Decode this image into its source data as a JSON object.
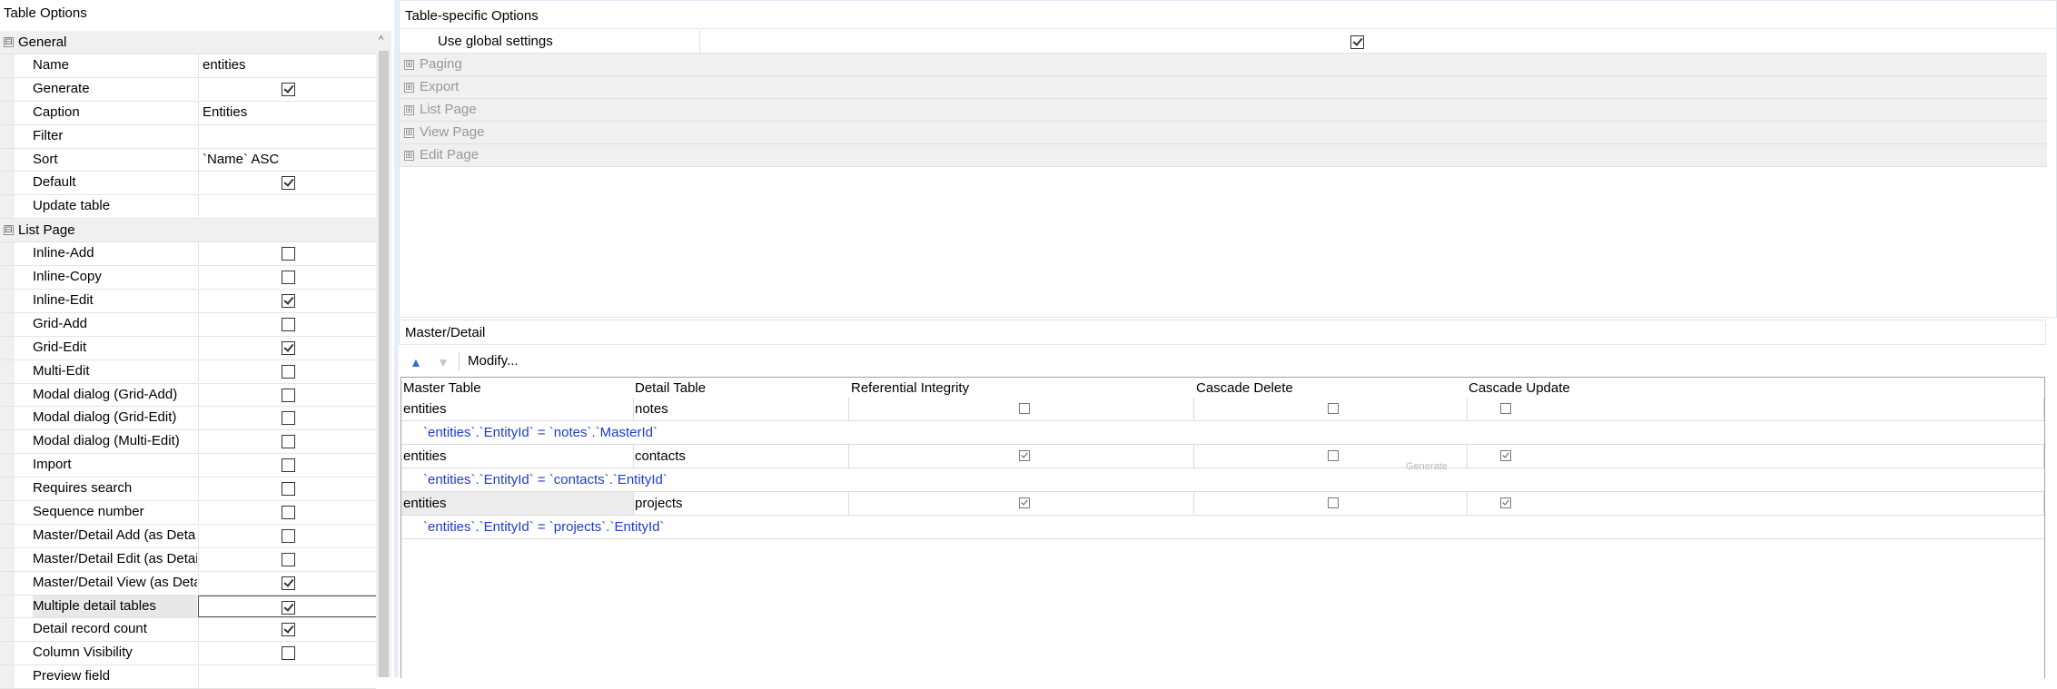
{
  "left": {
    "title": "Table Options",
    "categories": [
      {
        "label": "General",
        "expander": "⊟"
      },
      {
        "label": "List Page",
        "expander": "⊟"
      }
    ],
    "general": [
      {
        "name": "Name",
        "value": "entities"
      },
      {
        "name": "Generate",
        "checked": true
      },
      {
        "name": "Caption",
        "value": "Entities"
      },
      {
        "name": "Filter",
        "value": ""
      },
      {
        "name": "Sort",
        "value": "`Name` ASC"
      },
      {
        "name": "Default",
        "checked": true
      },
      {
        "name": "Update table",
        "value": ""
      }
    ],
    "list_page": [
      {
        "name": "Inline-Add",
        "checked": false
      },
      {
        "name": "Inline-Copy",
        "checked": false
      },
      {
        "name": "Inline-Edit",
        "checked": true
      },
      {
        "name": "Grid-Add",
        "checked": false
      },
      {
        "name": "Grid-Edit",
        "checked": true
      },
      {
        "name": "Multi-Edit",
        "checked": false
      },
      {
        "name": "Modal dialog (Grid-Add)",
        "checked": false
      },
      {
        "name": "Modal dialog (Grid-Edit)",
        "checked": false
      },
      {
        "name": "Modal dialog (Multi-Edit)",
        "checked": false
      },
      {
        "name": "Import",
        "checked": false
      },
      {
        "name": "Requires search",
        "checked": false
      },
      {
        "name": "Sequence number",
        "checked": false
      },
      {
        "name": "Master/Detail Add (as Deta",
        "checked": false
      },
      {
        "name": "Master/Detail Edit (as Detai",
        "checked": false
      },
      {
        "name": "Master/Detail View (as Deta",
        "checked": true
      },
      {
        "name": "Multiple detail tables",
        "checked": true,
        "selected": true
      },
      {
        "name": "Detail record count",
        "checked": true
      },
      {
        "name": "Column Visibility",
        "checked": false
      },
      {
        "name": "Preview field",
        "value": ""
      }
    ]
  },
  "right": {
    "title": "Table-specific Options",
    "use_global": {
      "label": "Use global settings",
      "checked": true
    },
    "sections": [
      {
        "label": "Paging",
        "expander": "⊞"
      },
      {
        "label": "Export",
        "expander": "⊞"
      },
      {
        "label": "List Page",
        "expander": "⊞"
      },
      {
        "label": "View Page",
        "expander": "⊞"
      },
      {
        "label": "Edit Page",
        "expander": "⊞"
      }
    ]
  },
  "master_detail": {
    "title": "Master/Detail",
    "toolbar": {
      "up_icon": "▲",
      "down_icon": "▼",
      "modify_label": "Modify..."
    },
    "columns": [
      "Master Table",
      "Detail Table",
      "Referential Integrity",
      "Cascade Delete",
      "Cascade Update"
    ],
    "rows": [
      {
        "master": "entities",
        "detail": "notes",
        "ref": false,
        "cdel": false,
        "cupd": false,
        "join": "`entities`.`EntityId` = `notes`.`MasterId`",
        "shaded": false
      },
      {
        "master": "entities",
        "detail": "contacts",
        "ref": true,
        "cdel": false,
        "cupd": true,
        "join": "`entities`.`EntityId` = `contacts`.`EntityId`",
        "shaded": false
      },
      {
        "master": "entities",
        "detail": "projects",
        "ref": true,
        "cdel": false,
        "cupd": true,
        "join": "`entities`.`EntityId` = `projects`.`EntityId`",
        "shaded": true
      }
    ],
    "ghost_text": "Generate"
  }
}
